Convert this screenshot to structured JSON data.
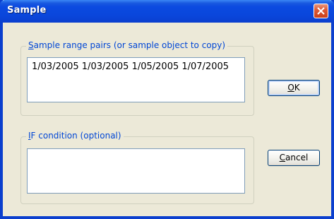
{
  "window": {
    "title": "Sample"
  },
  "sample_group": {
    "legend_accel": "S",
    "legend_rest": "ample range pairs (or sample object to copy)",
    "value": "1/03/2005 1/03/2005 1/05/2005 1/07/2005"
  },
  "condition_group": {
    "legend_accel": "I",
    "legend_rest": "F condition (optional)",
    "value": ""
  },
  "buttons": {
    "ok_accel": "O",
    "ok_rest": "K",
    "cancel_accel": "C",
    "cancel_rest": "ancel"
  },
  "icons": {
    "close": "close-x-icon"
  },
  "colors": {
    "titlebar": "#0a46db",
    "dialog_bg": "#ece9d8",
    "legend_text": "#0046d5",
    "close_button": "#dd5a36"
  }
}
